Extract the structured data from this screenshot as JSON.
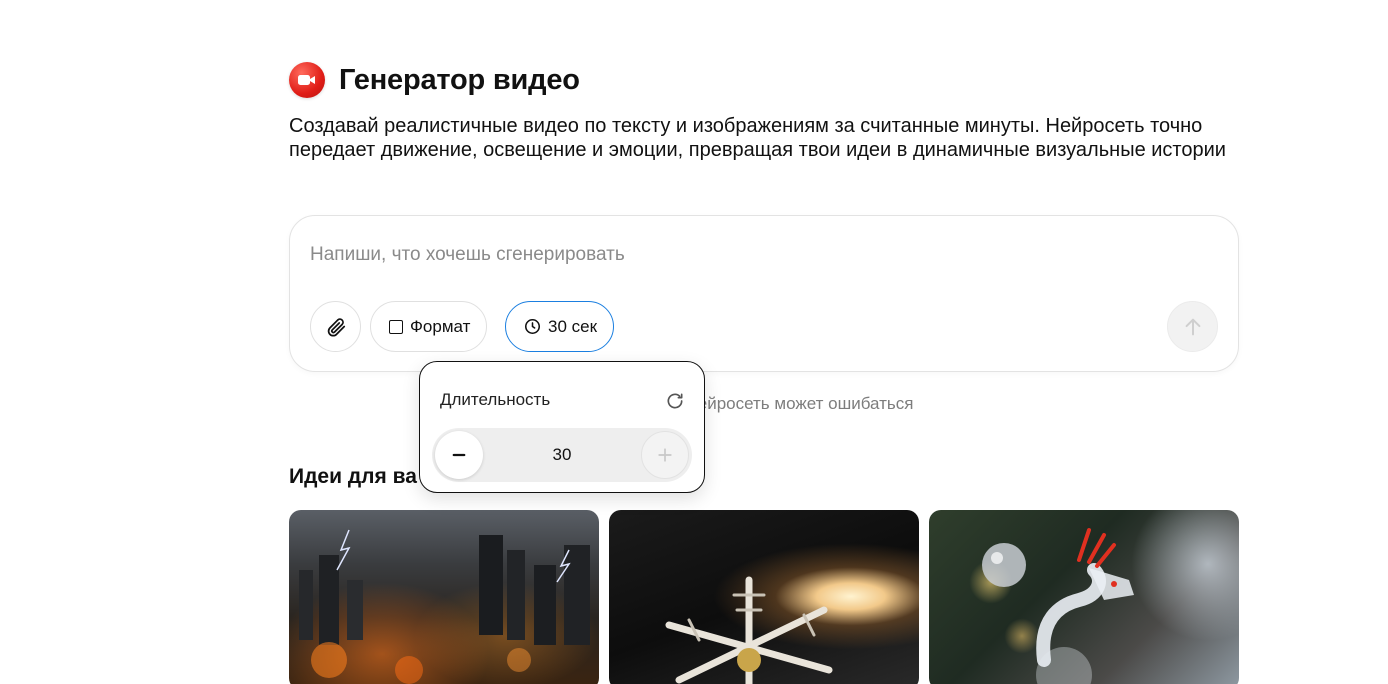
{
  "header": {
    "title": "Генератор видео",
    "logo_icon": "video-camera-icon",
    "logo_color": "#e01d17"
  },
  "description": "Создавай реалистичные видео по тексту и изображениям за считанные минуты. Нейросеть точно передает движение, освещение и эмоции, превращая твои идеи в динамичные визуальные истории",
  "prompt": {
    "placeholder": "Напиши, что хочешь сгенерировать",
    "value": "",
    "attach_icon": "paperclip-icon",
    "format_label": "Формат",
    "format_icon": "square-icon",
    "duration_label": "30 сек",
    "duration_icon": "clock-icon",
    "duration_active_color": "#1b7fe0",
    "send_icon": "arrow-up-icon"
  },
  "disclaimer": "о видео. Нейросеть может ошибаться",
  "ideas": {
    "title": "Идеи для ва",
    "cards": [
      {
        "image": "stormy-burning-city"
      },
      {
        "image": "jeweled-snowflake-with-candle"
      },
      {
        "image": "glass-dragon-ornament-christmas-tree"
      }
    ]
  },
  "duration_popover": {
    "title": "Длительность",
    "reset_icon": "refresh-icon",
    "value": "30",
    "minus_icon": "minus-icon",
    "plus_icon": "plus-icon"
  }
}
